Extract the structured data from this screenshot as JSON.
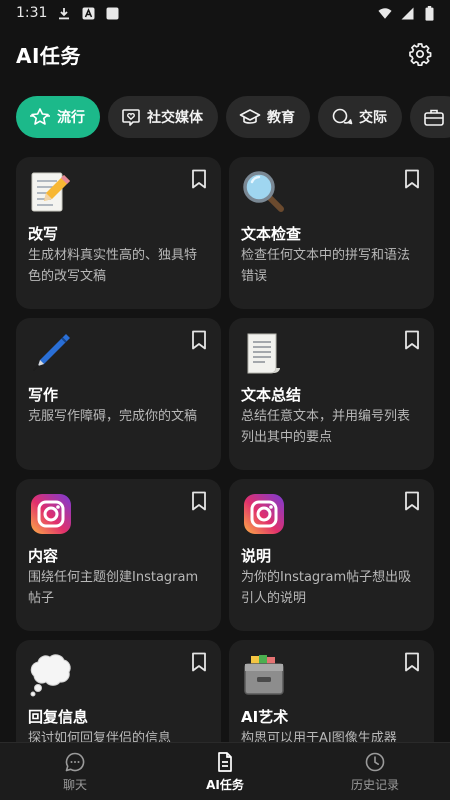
{
  "status_bar": {
    "time": "1:31"
  },
  "app_bar": {
    "title": "AI任务"
  },
  "categories": [
    {
      "label": "流行",
      "icon": "star-burst-icon",
      "active": true
    },
    {
      "label": "社交媒体",
      "icon": "chat-heart-icon",
      "active": false
    },
    {
      "label": "教育",
      "icon": "graduation-cap-icon",
      "active": false
    },
    {
      "label": "交际",
      "icon": "chat-bubbles-icon",
      "active": false
    },
    {
      "label": "",
      "icon": "briefcase-icon",
      "active": false
    }
  ],
  "cards": [
    {
      "emoji": "📝",
      "icon": "memo-pencil-icon",
      "title": "改写",
      "description": "生成材料真实性高的、独具特色的改写文稿"
    },
    {
      "emoji": "🔍",
      "icon": "magnifying-glass-icon",
      "title": "文本检查",
      "description": "检查任何文本中的拼写和语法错误"
    },
    {
      "emoji": "🖊️",
      "icon": "pen-icon",
      "title": "写作",
      "description": "克服写作障碍，完成你的文稿"
    },
    {
      "emoji": "📃",
      "icon": "page-curl-icon",
      "title": "文本总结",
      "description": "总结任意文本，并用编号列表列出其中的要点"
    },
    {
      "emoji": "",
      "icon": "instagram-icon",
      "title": "内容",
      "description": "围绕任何主题创建Instagram帖子"
    },
    {
      "emoji": "",
      "icon": "instagram-icon",
      "title": "说明",
      "description": "为你的Instagram帖子想出吸引人的说明"
    },
    {
      "emoji": "💭",
      "icon": "thought-bubble-icon",
      "title": "回复信息",
      "description": "探讨如何回复伴侣的信息"
    },
    {
      "emoji": "🗃️",
      "icon": "card-file-box-icon",
      "title": "AI艺术",
      "description": "构思可以用于AI图像生成器"
    }
  ],
  "bottom_nav": {
    "chat_label": "聊天",
    "tasks_label": "AI任务",
    "history_label": "历史记录",
    "active": "AI任务"
  }
}
